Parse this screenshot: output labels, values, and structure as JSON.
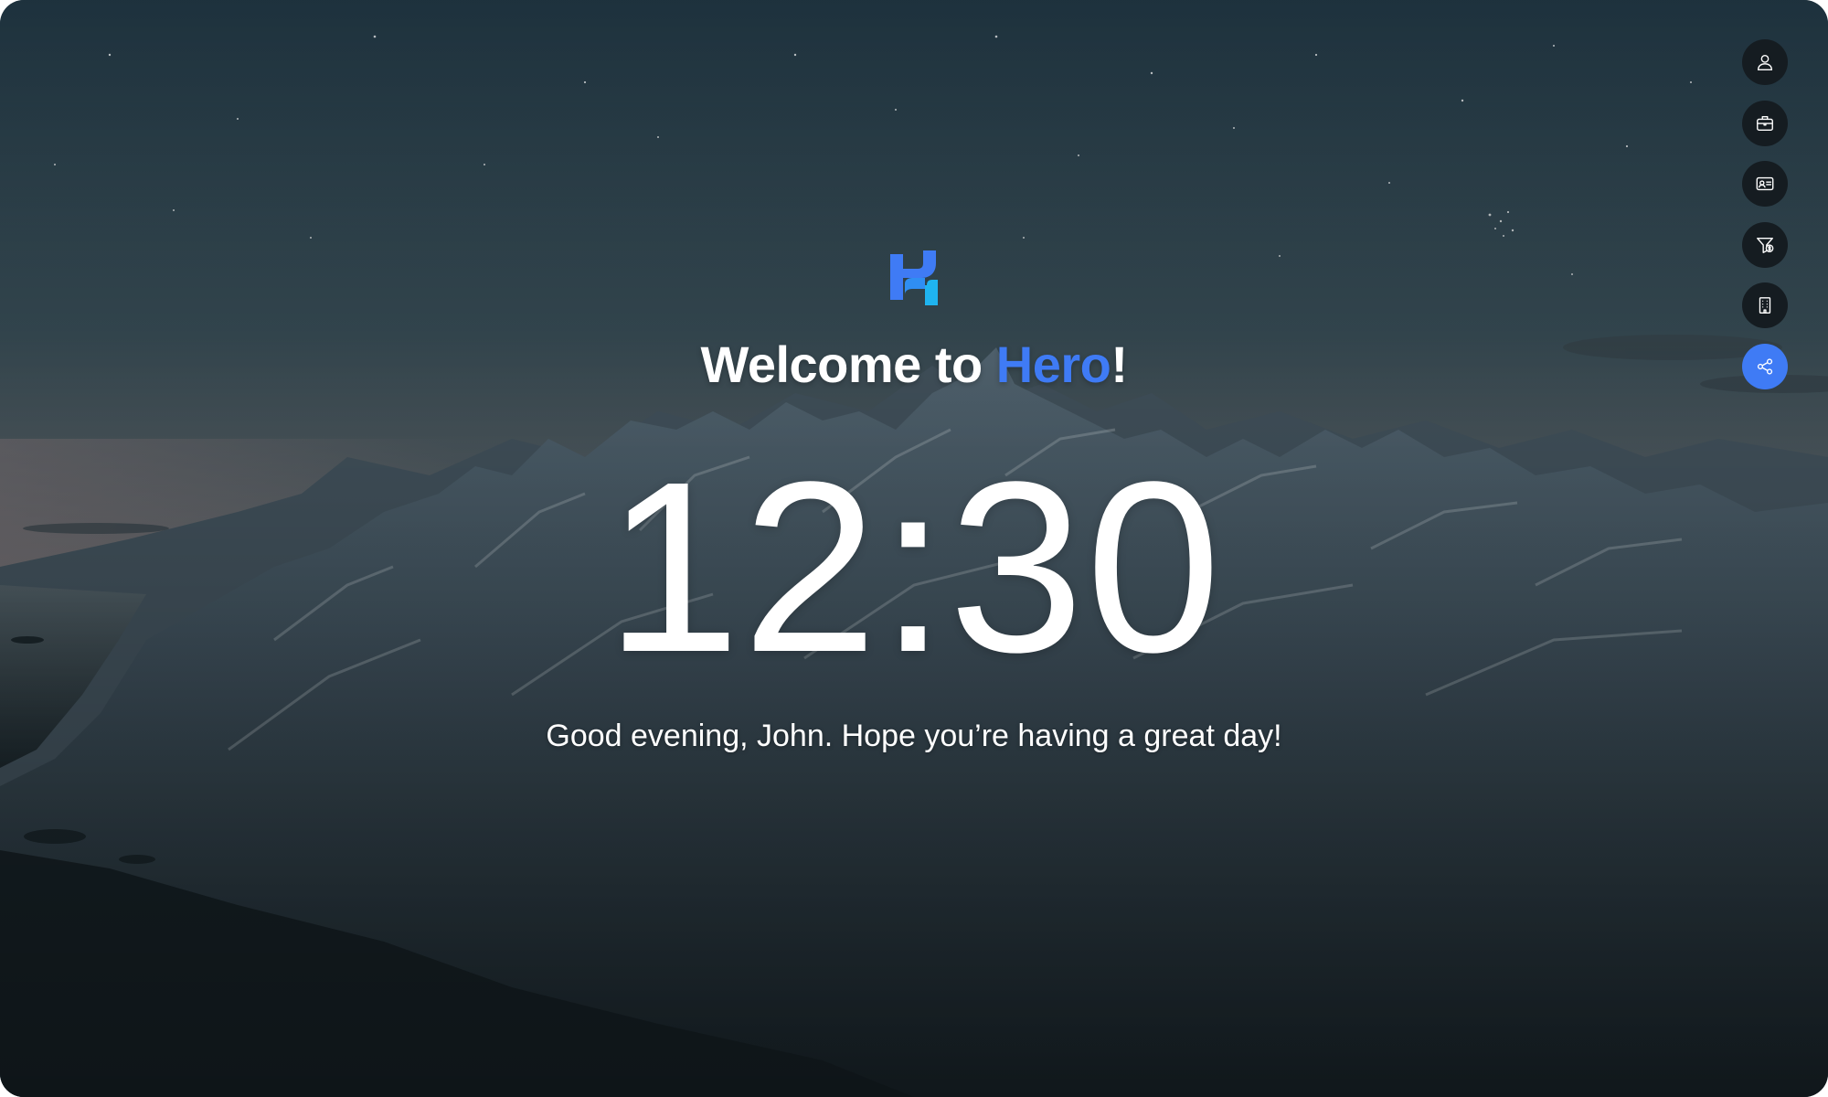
{
  "app": {
    "name": "Hero",
    "accent_color": "#3f7bf5"
  },
  "welcome": {
    "prefix": "Welcome to ",
    "brand": "Hero",
    "suffix": "!"
  },
  "clock": {
    "time": "12:30"
  },
  "greeting": {
    "text": "Good evening, John. Hope you’re having a great day!"
  },
  "sidebar": {
    "items": [
      {
        "icon": "user-icon",
        "active": false
      },
      {
        "icon": "briefcase-icon",
        "active": false
      },
      {
        "icon": "id-card-icon",
        "active": false
      },
      {
        "icon": "funnel-dollar-icon",
        "active": false
      },
      {
        "icon": "building-icon",
        "active": false
      },
      {
        "icon": "share-icon",
        "active": true
      }
    ]
  }
}
